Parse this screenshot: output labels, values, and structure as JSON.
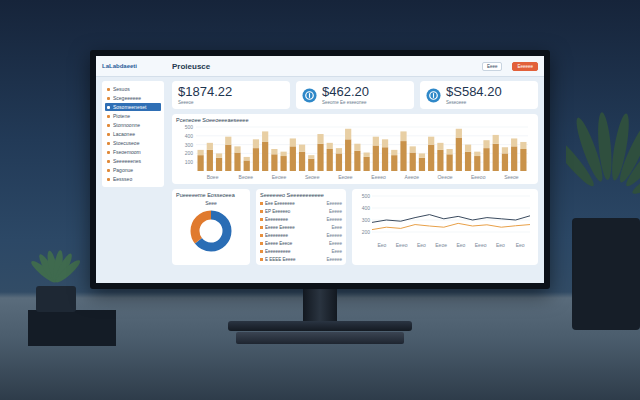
{
  "logo": "LaLabdaeeti",
  "page_title": "Proieusce",
  "header_buttons": [
    {
      "label": "Eeee",
      "kind": "plain"
    },
    {
      "label": "Eeeeee",
      "kind": "accent"
    }
  ],
  "sidebar": {
    "items": [
      {
        "label": "Sesuos",
        "selected": false
      },
      {
        "label": "Scegeeeeee",
        "selected": false
      },
      {
        "label": "Sosomeeneset",
        "selected": true
      },
      {
        "label": "Piotene",
        "selected": false
      },
      {
        "label": "Stonnoonne",
        "selected": false
      },
      {
        "label": "Lacaonee",
        "selected": false
      },
      {
        "label": "Stoecuseoe",
        "selected": false
      },
      {
        "label": "Fseoemoom",
        "selected": false
      },
      {
        "label": "Seeeeeenes",
        "selected": false
      },
      {
        "label": "Pagonue",
        "selected": false
      },
      {
        "label": "Eessseo",
        "selected": false
      }
    ]
  },
  "stats": [
    {
      "value": "$1874.22",
      "caption": "Seeeoe",
      "kind": "plain"
    },
    {
      "value": "$462.20",
      "caption": "Seeome Ee eseeonee",
      "kind": "icon"
    },
    {
      "value": "$S584.20",
      "caption": "Seseoeee",
      "kind": "icon"
    }
  ],
  "bar_chart": {
    "title": "Pceneoee Soeeoeeeaeseeee",
    "ticks": [
      "500",
      "400",
      "300",
      "200",
      "100"
    ],
    "x_labels": [
      "Boee",
      "Beoee",
      "Eeoee",
      "Seoee",
      "Eeoee",
      "Eeeeo",
      "Aeeoe",
      "Oeeoe",
      "Eeeoo",
      "Seeoe"
    ],
    "series": [
      {
        "name": "base",
        "color": "#c9924a",
        "values": [
          180,
          240,
          150,
          300,
          210,
          120,
          260,
          330,
          190,
          170,
          280,
          220,
          140,
          310,
          250,
          200,
          360,
          230,
          160,
          290,
          270,
          180,
          340,
          210,
          150,
          300,
          240,
          190,
          380,
          220,
          170,
          260,
          310,
          200,
          280,
          250
        ]
      },
      {
        "name": "top",
        "color": "#e8cfa4",
        "values": [
          60,
          80,
          50,
          90,
          70,
          40,
          100,
          120,
          60,
          50,
          90,
          80,
          40,
          110,
          70,
          60,
          120,
          80,
          50,
          100,
          90,
          60,
          110,
          70,
          50,
          90,
          80,
          60,
          100,
          80,
          50,
          90,
          100,
          70,
          90,
          80
        ]
      }
    ]
  },
  "donut": {
    "title": "Pueeeeeme Eosseoeea",
    "subtitle": "Seee",
    "segments": [
      {
        "value": 64,
        "color": "#2a6db5"
      },
      {
        "value": 36,
        "color": "#e07a2e"
      }
    ]
  },
  "table": {
    "title": "Seeeeeeo Seeeeeeeeeee",
    "rows": [
      {
        "name": "Eee Eeeeeeee",
        "value": "Eeeeee"
      },
      {
        "name": "EP Eeeeeeo",
        "value": "Eeeee"
      },
      {
        "name": "Eeeeeeeee",
        "value": "Eeeeee"
      },
      {
        "name": "Eeeee Eeeeee",
        "value": "Eeee"
      },
      {
        "name": "Eeeeeeeee",
        "value": "Eeeeee"
      },
      {
        "name": "Eeeee Eeeoe",
        "value": "Eeeee"
      },
      {
        "name": "Eeeeeeeeee",
        "value": "Eeee"
      },
      {
        "name": "E EEEE Eeeee",
        "value": "Eeeeee"
      }
    ]
  },
  "line_chart": {
    "ticks": [
      "500",
      "400",
      "300",
      "200"
    ],
    "x_labels": [
      "Eeo",
      "Eeeo",
      "Eeo",
      "Eeoe",
      "Eeo",
      "Eeeo",
      "Eeo",
      "Eeo"
    ],
    "series": [
      {
        "color": "#3a4a5e",
        "values": [
          280,
          300,
          290,
          320,
          345,
          310,
          330,
          300,
          320,
          310,
          300,
          335
        ]
      },
      {
        "color": "#e8a048",
        "values": [
          220,
          240,
          230,
          262,
          250,
          240,
          272,
          250,
          260,
          240,
          252,
          262
        ]
      }
    ]
  }
}
